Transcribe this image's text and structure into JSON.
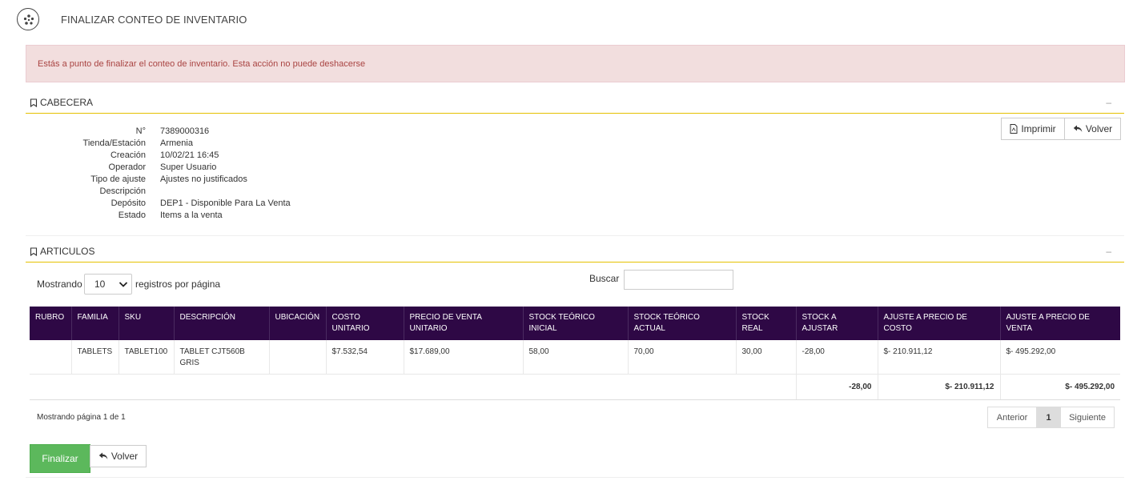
{
  "header": {
    "title": "FINALIZAR CONTEO DE INVENTARIO",
    "icon": "cluster-icon"
  },
  "alert": {
    "message": "Estás a punto de finalizar el conteo de inventario. Esta acción no puede deshacerse"
  },
  "cabecera": {
    "title": "CABECERA",
    "collapse": "–",
    "fields": [
      {
        "label": "N°",
        "value": "7389000316"
      },
      {
        "label": "Tienda/Estación",
        "value": "Armenia"
      },
      {
        "label": "Creación",
        "value": "10/02/21 16:45"
      },
      {
        "label": "Operador",
        "value": "Super Usuario"
      },
      {
        "label": "Tipo de ajuste",
        "value": "Ajustes no justificados"
      },
      {
        "label": "Descripción",
        "value": ""
      },
      {
        "label": "Depósito",
        "value": "DEP1 - Disponible Para La Venta"
      },
      {
        "label": "Estado",
        "value": "Items a la venta"
      }
    ],
    "print_label": "Imprimir",
    "back_label": "Volver"
  },
  "articulos": {
    "title": "ARTICULOS",
    "collapse": "–",
    "showing_label": "Mostrando",
    "page_size": "10",
    "per_page_label": "registros por página",
    "search_label": "Buscar",
    "search_value": "",
    "columns": [
      "RUBRO",
      "FAMILIA",
      "SKU",
      "DESCRIPCIÓN",
      "UBICACIÓN",
      "COSTO UNITARIO",
      "PRECIO DE VENTA UNITARIO",
      "STOCK TEÓRICO INICIAL",
      "STOCK TEÓRICO ACTUAL",
      "STOCK REAL",
      "STOCK A AJUSTAR",
      "AJUSTE A PRECIO DE COSTO",
      "AJUSTE A PRECIO DE VENTA"
    ],
    "rows": [
      [
        "",
        "TABLETS",
        "TABLET100",
        "TABLET CJT560B GRIS",
        "",
        "$7.532,54",
        "$17.689,00",
        "58,00",
        "70,00",
        "30,00",
        "-28,00",
        "$- 210.911,12",
        "$- 495.292,00"
      ]
    ],
    "totals": {
      "stock_ajustar": "-28,00",
      "ajuste_costo": "$- 210.911,12",
      "ajuste_venta": "$- 495.292,00"
    },
    "paging_info": "Mostrando página 1 de 1",
    "pager": {
      "prev": "Anterior",
      "current": "1",
      "next": "Siguiente"
    }
  },
  "footer": {
    "finalize_label": "Finalizar",
    "back_label": "Volver"
  },
  "colors": {
    "header_bg": "#2e0845",
    "accent_line": "#e5c100",
    "finalize_bg": "#5cb85c",
    "alert_bg": "#f2dede",
    "alert_text": "#a94442"
  }
}
